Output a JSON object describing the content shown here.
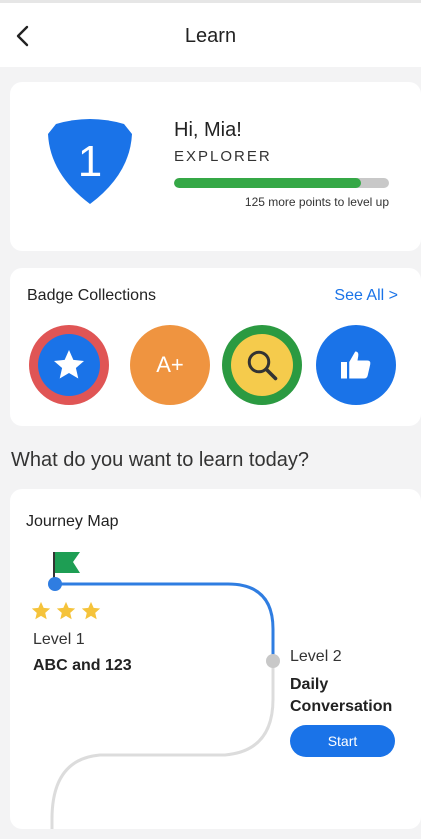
{
  "header": {
    "title": "Learn"
  },
  "profile": {
    "level_number": "1",
    "greeting": "Hi, Mia!",
    "rank": "EXPLORER",
    "progress_fraction": 0.87,
    "points_text": "125 more points to level up"
  },
  "badges": {
    "title": "Badge Collections",
    "see_all": "See All >",
    "items": [
      {
        "icon": "star-icon"
      },
      {
        "label": "A+"
      },
      {
        "icon": "magnifier-icon"
      },
      {
        "icon": "thumbs-up-icon"
      }
    ]
  },
  "question": "What do you want to learn today?",
  "journey": {
    "title": "Journey Map",
    "level1": {
      "label": "Level 1",
      "name": "ABC and 123",
      "stars": 3
    },
    "level2": {
      "label": "Level 2",
      "name": "Daily Conversation",
      "start_label": "Start"
    }
  },
  "colors": {
    "accent": "#1a73e8",
    "progress": "#35a846",
    "star": "#f5c33b",
    "flag": "#1e9e54"
  }
}
